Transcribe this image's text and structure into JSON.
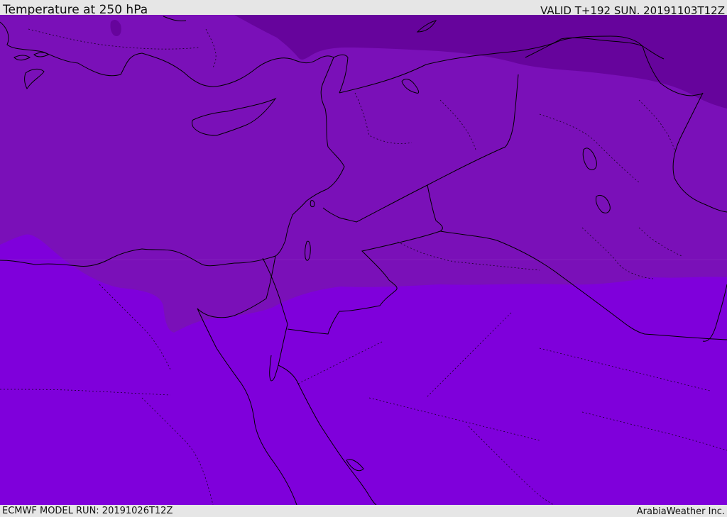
{
  "header": {
    "title": "Temperature at 250 hPa",
    "valid_time": "VALID T+192 SUN. 20191103T12Z"
  },
  "footer": {
    "model_run": "ECMWF MODEL RUN: 20191026T12Z",
    "credit": "ArabiaWeather Inc."
  },
  "map": {
    "field": "temperature",
    "level": "250 hPa",
    "colors": {
      "coldest_band": "#66049c",
      "middle_band": "#7a10b8",
      "warm_band": "#7f00db",
      "coastline": "#000000",
      "border": "#000000"
    }
  }
}
